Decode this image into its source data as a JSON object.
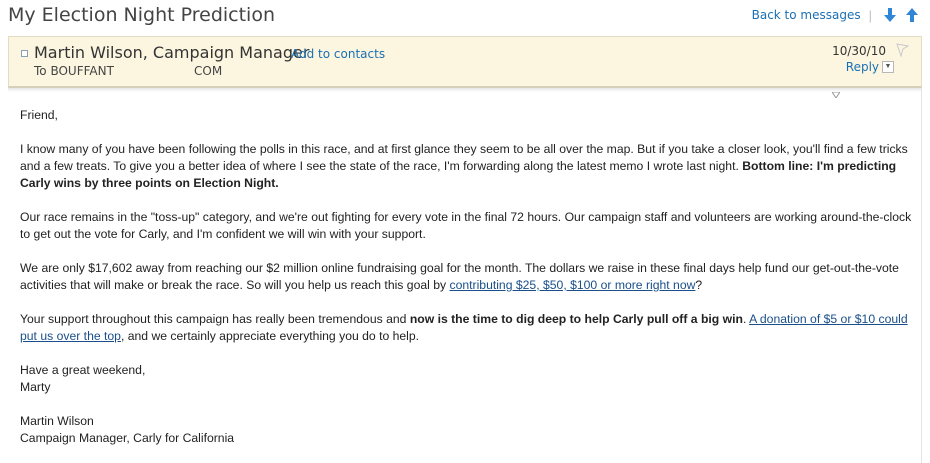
{
  "message": {
    "subject": "My Election Night Prediction",
    "back_label": "Back to messages",
    "from": "Martin Wilson, Campaign Manager",
    "add_contacts_label": "Add to contacts",
    "to_prefix": "To BOUFFANT",
    "to_suffix": "COM",
    "date": "10/30/10",
    "reply_label": "Reply"
  },
  "body": {
    "greeting": "Friend,",
    "p1_text": "I know many of you have been following the polls in this race, and at first glance they seem to be all over the map. But if you take a closer look, you'll find a few tricks and a few treats. To give you a better idea of where I see the state of the race, I'm forwarding along the latest memo I wrote last night. ",
    "p1_bold": "Bottom line: I'm predicting Carly wins by three points on Election Night.",
    "p2_text": "Our race remains in the \"toss-up\" category, and we're out fighting for every vote in the final 72 hours. Our campaign staff and volunteers are working around-the-clock to get out the vote for Carly, and I'm confident we will win with your support.",
    "p3_text": "We are only $17,602 away from reaching our $2 million online fundraising goal for the month. The dollars we raise in these final days help fund our get-out-the-vote activities that will make or break the race. So will you help us reach this goal by ",
    "p3_link": "contributing $25, $50, $100 or more right now",
    "p3_end": "?",
    "p4_text": "Your support throughout this campaign has really been tremendous and ",
    "p4_bold": "now is the time to dig deep to help Carly pull off a big win",
    "p4_mid": ". ",
    "p4_link": "A donation of $5 or $10 could put us over the top",
    "p4_end": ", and we certainly appreciate everything you do to help.",
    "closing1": "Have a great weekend,",
    "closing2": "Marty",
    "sig_name": "Martin Wilson",
    "sig_title": "Campaign Manager, Carly for California"
  },
  "icons": {
    "next": "arrow-down-icon",
    "prev": "arrow-up-icon",
    "flag": "flag-icon",
    "collapse": "collapse-icon",
    "expand": "expand-icon"
  },
  "colors": {
    "link": "#1a6fb3",
    "header_bg": "#fcf6e1",
    "arrow": "#2f86d6"
  }
}
